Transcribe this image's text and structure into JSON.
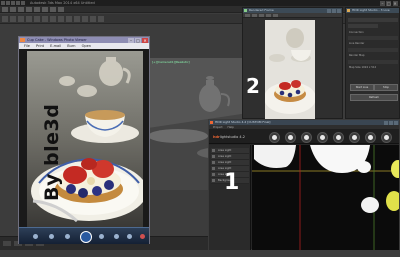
{
  "app": {
    "title": "Autodesk 3ds Max 2014 x64    Untitled",
    "min_label": "–",
    "max_label": "□",
    "close_label": "✕"
  },
  "viewport": {
    "label": "[+][Camera01][Realistic]"
  },
  "photo_viewer": {
    "title": "Cup Cake - Windows Photo Viewer",
    "menu": [
      "File",
      "Print",
      "E-mail",
      "Burn",
      "Open"
    ],
    "overlay_text": "By ble3d",
    "nav_icons": [
      "zoom-icon",
      "previous-icon",
      "play-slideshow-icon",
      "next-icon",
      "rotate-ccw-icon",
      "rotate-cw-icon",
      "delete-icon"
    ]
  },
  "render_window": {
    "title": "Rendered Frame",
    "big_label": "2"
  },
  "settings_panel": {
    "title": "HDR Light Studio - 3 Live",
    "fields": [
      "Connection",
      "Live Render",
      "Render Map",
      "Map Size 1024 x 512"
    ],
    "buttons": [
      "Start Live",
      "Stop",
      "Refresh"
    ]
  },
  "hdr_light_studio": {
    "title": "HDR Light Studio 4.2 [CUSTOM Final]",
    "menu": [
      "Project",
      "Help"
    ],
    "logo_prefix": "hdr",
    "logo_main": "lightstudio",
    "logo_suffix": "4.2",
    "lights": [
      "Area Light",
      "Area Light",
      "Area Light",
      "Area Light",
      "Area Light",
      "Background"
    ],
    "big_label": "1"
  },
  "colors": {
    "app_background": "#3c3c3c",
    "photo_viewer_title": "#8e8db3",
    "hdr_accent": "#e86a33"
  }
}
